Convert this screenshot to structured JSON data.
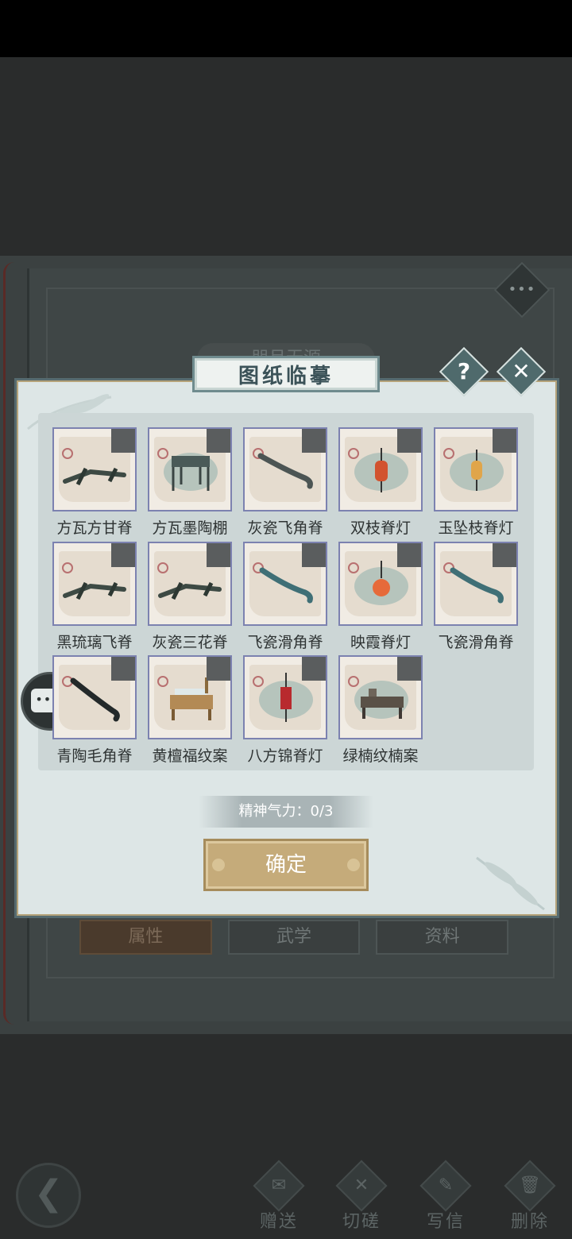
{
  "background": {
    "title": "朋月无源",
    "tabs": [
      "属性",
      "武学",
      "资料"
    ],
    "dots_label": "•••"
  },
  "dialog": {
    "title": "图纸临摹",
    "help_glyph": "?",
    "close_glyph": "✕",
    "items": [
      {
        "name": "方瓦方甘脊",
        "picture": "rafter-pieces"
      },
      {
        "name": "方瓦墨陶棚",
        "picture": "canopy-frame"
      },
      {
        "name": "灰瓷飞角脊",
        "picture": "curved-ridge"
      },
      {
        "name": "双枝脊灯",
        "picture": "red-lantern"
      },
      {
        "name": "玉坠枝脊灯",
        "picture": "gold-lantern"
      },
      {
        "name": "黑琉璃飞脊",
        "picture": "rafter-pieces"
      },
      {
        "name": "灰瓷三花脊",
        "picture": "rafter-pieces"
      },
      {
        "name": "飞瓷滑角脊",
        "picture": "teal-ridge"
      },
      {
        "name": "映霞脊灯",
        "picture": "round-lantern"
      },
      {
        "name": "飞瓷滑角脊",
        "picture": "teal-ridge"
      },
      {
        "name": "青陶毛角脊",
        "picture": "dark-ridge"
      },
      {
        "name": "黄檀福纹案",
        "picture": "desk"
      },
      {
        "name": "八方锦脊灯",
        "picture": "hanging-lantern"
      },
      {
        "name": "绿楠纹楠案",
        "picture": "desk-dark"
      }
    ],
    "stamina_text": "精神气力：0/3",
    "confirm_label": "确定"
  },
  "chat_bubble": {
    "label": "•••"
  },
  "bottom": {
    "back_glyph": "❮",
    "actions": [
      {
        "label": "赠送",
        "icon": "scroll-icon",
        "glyph": "✉"
      },
      {
        "label": "切磋",
        "icon": "sword-icon",
        "glyph": "✕"
      },
      {
        "label": "写信",
        "icon": "letter-icon",
        "glyph": "✎"
      },
      {
        "label": "删除",
        "icon": "trash-icon",
        "glyph": "🗑"
      }
    ]
  },
  "colors": {
    "dialog_bg": "#dde6e6",
    "card_border": "#7c82b0",
    "confirm_bg": "#c5ab7a",
    "title_text": "#3b5258"
  }
}
